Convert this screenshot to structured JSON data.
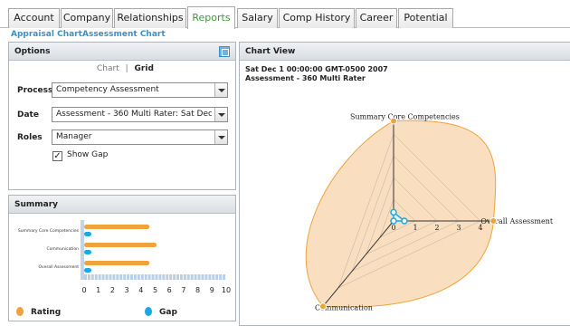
{
  "tabs": [
    {
      "label": "Account",
      "active": false
    },
    {
      "label": "Company",
      "active": false
    },
    {
      "label": "Relationships",
      "active": false
    },
    {
      "label": "Reports",
      "active": true
    },
    {
      "label": "Salary",
      "active": false
    },
    {
      "label": "Comp History",
      "active": false
    },
    {
      "label": "Career",
      "active": false
    },
    {
      "label": "Potential",
      "active": false
    }
  ],
  "sublinks": [
    "Appraisal Chart",
    "Assessment Chart"
  ],
  "options": {
    "title": "Options",
    "view_chart": "Chart",
    "separator": "|",
    "view_grid": "Grid",
    "process_label": "Process",
    "process_value": "Competency Assessment",
    "date_label": "Date",
    "date_value": "Assessment - 360 Multi Rater: Sat Dec 1 00:00:00",
    "roles_label": "Roles",
    "roles_value": "Manager",
    "show_gap_label": "Show Gap",
    "show_gap_checked": true,
    "check_mark": "✓"
  },
  "summary": {
    "title": "Summary",
    "legend": [
      {
        "label": "Rating",
        "color": "#f0a23c"
      },
      {
        "label": "Gap",
        "color": "#1ba8e0"
      }
    ]
  },
  "chart_view": {
    "title": "Chart View",
    "date_line": "Sat Dec 1 00:00:00 GMT-0500 2007",
    "assessment_line": "Assessment - 360 Multi Rater"
  },
  "chart_data": [
    {
      "type": "bar",
      "orientation": "horizontal",
      "categories": [
        "Summary Core Competencies",
        "Communication",
        "Overall Assessment"
      ],
      "series": [
        {
          "name": "Rating",
          "values": [
            4.6,
            5.1,
            4.6
          ],
          "color": "#f0a23c"
        },
        {
          "name": "Gap",
          "values": [
            0.4,
            0.0,
            0.5
          ],
          "color": "#1ba8e0"
        }
      ],
      "xlim": [
        0,
        10
      ],
      "ticks": [
        0,
        1,
        2,
        3,
        4,
        5,
        6,
        7,
        8,
        9,
        10
      ],
      "legend_position": "bottom"
    },
    {
      "type": "radar",
      "axes": [
        "Summary Core Competencies",
        "Overall Assessment",
        "Communication"
      ],
      "ticks": [
        0,
        1,
        2,
        3,
        4
      ],
      "rmax": 4.5,
      "series": [
        {
          "name": "Rating",
          "values": [
            4.6,
            4.6,
            5.1
          ],
          "color": "#f0a23c"
        },
        {
          "name": "Gap",
          "values": [
            0.4,
            0.5,
            0.0
          ],
          "color": "#1ba8e0"
        }
      ]
    }
  ]
}
